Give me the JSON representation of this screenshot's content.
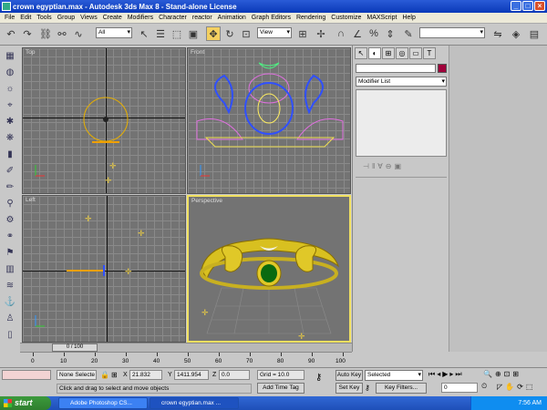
{
  "window": {
    "title": "crown egyptian.max - Autodesk 3ds Max 8 - Stand-alone License"
  },
  "menu": [
    "File",
    "Edit",
    "Tools",
    "Group",
    "Views",
    "Create",
    "Modifiers",
    "Character",
    "reactor",
    "Animation",
    "Graph Editors",
    "Rendering",
    "Customize",
    "MAXScript",
    "Help"
  ],
  "toolbar": {
    "selection_filter": "All",
    "ref_coord": "View",
    "named_selection": ""
  },
  "viewports": {
    "top": "Top",
    "front": "Front",
    "left": "Left",
    "perspective": "Perspective"
  },
  "command_panel": {
    "modifier_list": "Modifier List",
    "object_color": "#a0003a"
  },
  "timeline": {
    "slider": "0 / 100",
    "ticks": [
      "0",
      "10",
      "20",
      "30",
      "40",
      "50",
      "60",
      "70",
      "80",
      "90",
      "100"
    ]
  },
  "status": {
    "selection": "None Selecte",
    "x_label": "X",
    "x_value": "21.832",
    "y_label": "Y",
    "y_value": "1411.954",
    "z_label": "Z",
    "z_value": "0.0",
    "grid": "Grid = 10.0",
    "prompt": "Click and drag to select and move objects",
    "add_time_tag": "Add Time Tag",
    "auto_key": "Auto Key",
    "set_key": "Set Key",
    "key_mode": "Selected",
    "key_filters": "Key Filters...",
    "frame": "0"
  },
  "taskbar": {
    "start": "start",
    "task1": "Adobe Photoshop CS...",
    "task2": "crown egyptian.max ...",
    "clock": "7:56 AM"
  }
}
